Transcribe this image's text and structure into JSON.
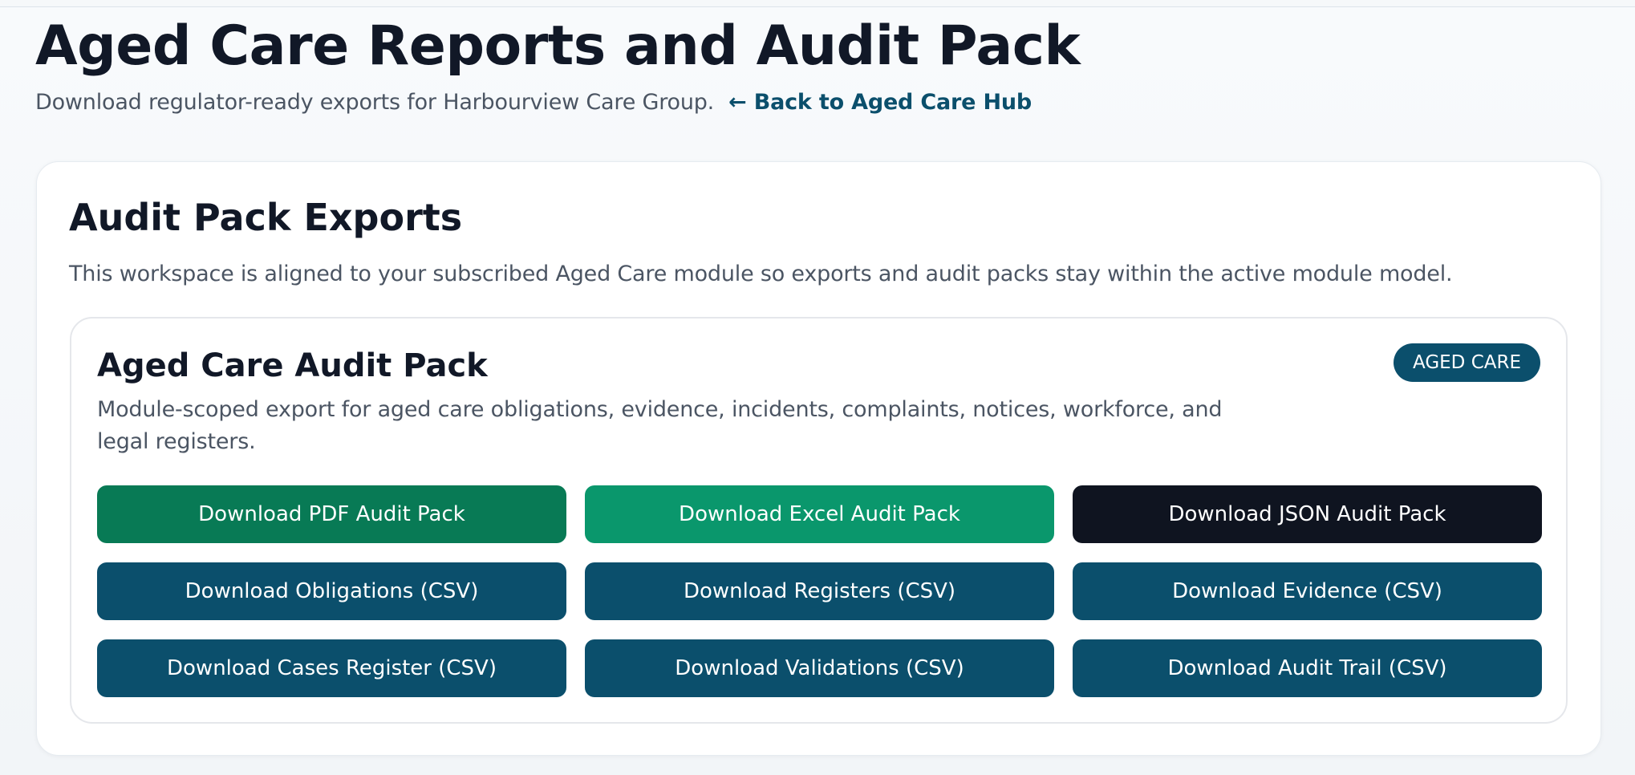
{
  "header": {
    "title": "Aged Care Reports and Audit Pack",
    "subtitle": "Download regulator-ready exports for Harbourview Care Group.",
    "back_link": "← Back to Aged Care Hub"
  },
  "section": {
    "title": "Audit Pack Exports",
    "description": "This workspace is aligned to your subscribed Aged Care module so exports and audit packs stay within the active module model."
  },
  "pack": {
    "title": "Aged Care Audit Pack",
    "badge": "AGED CARE",
    "description": "Module-scoped export for aged care obligations, evidence, incidents, complaints, notices, workforce, and legal registers."
  },
  "buttons": {
    "pdf": "Download PDF Audit Pack",
    "excel": "Download Excel Audit Pack",
    "json": "Download JSON Audit Pack",
    "obligations": "Download Obligations (CSV)",
    "registers": "Download Registers (CSV)",
    "evidence": "Download Evidence (CSV)",
    "cases": "Download Cases Register (CSV)",
    "validations": "Download Validations (CSV)",
    "audit_trail": "Download Audit Trail (CSV)"
  },
  "colors": {
    "primary": "#0b4f6c",
    "pdf_green": "#087a55",
    "excel_green": "#0a976c",
    "json_dark": "#0f1420"
  }
}
